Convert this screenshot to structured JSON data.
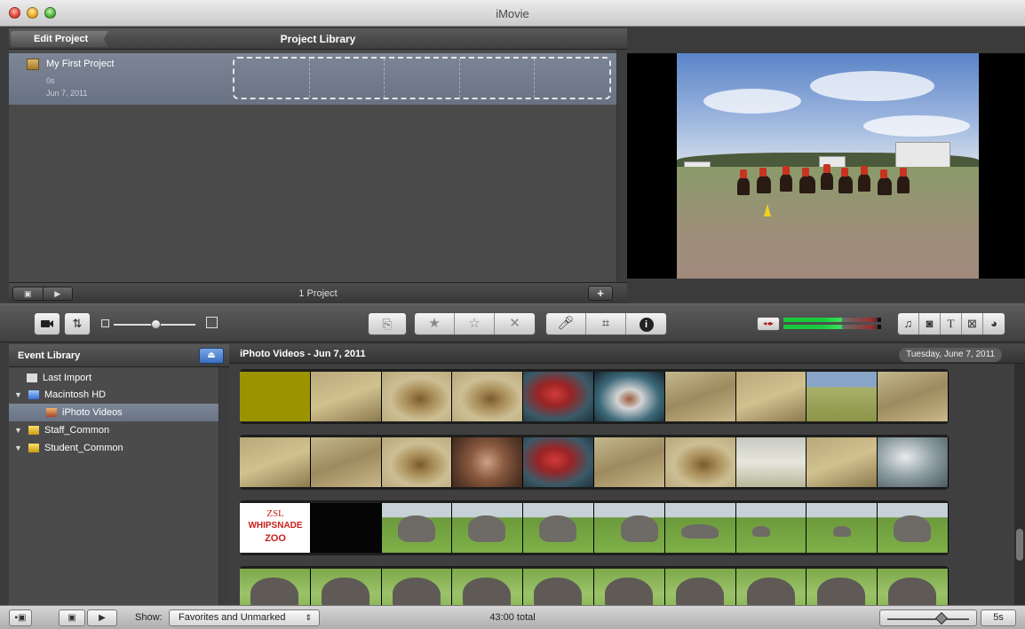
{
  "window": {
    "title": "iMovie"
  },
  "project_library": {
    "edit_button": "Edit Project",
    "title": "Project Library",
    "project": {
      "name": "My First Project",
      "duration": "0s",
      "date": "Jun 7, 2011"
    },
    "count_label": "1 Project",
    "add_label": "+"
  },
  "toolbar": {
    "thumbnail_zoom": 0.5,
    "edit_tools": [
      "star-icon",
      "empty-star-icon",
      "reject-x-icon"
    ],
    "tool_icons": [
      "voiceover-mic-icon",
      "crop-icon",
      "info-icon"
    ],
    "browser_icons": [
      "music-icon",
      "photo-icon",
      "titles-icon",
      "transitions-icon",
      "maps-icon"
    ]
  },
  "event_library": {
    "title": "Event Library",
    "items": [
      {
        "label": "Last Import"
      },
      {
        "label": "Macintosh HD"
      },
      {
        "label": "iPhoto Videos"
      },
      {
        "label": "Staff_Common"
      },
      {
        "label": "Student_Common"
      }
    ]
  },
  "event_browser": {
    "title": "iPhoto Videos - Jun 7, 2011",
    "date": "Tuesday, June 7, 2011",
    "zsl": {
      "line1": "ZSL",
      "line2": "WHIPSNADE",
      "line3": "ZOO"
    }
  },
  "bottom_bar": {
    "show_label": "Show:",
    "filter_value": "Favorites and Unmarked",
    "total": "43:00 total",
    "zoom_level": "5s"
  },
  "colors": {
    "selection": "#6f7a8b",
    "olive_clip": "#9a9400",
    "meter_green": "#19c93c"
  }
}
